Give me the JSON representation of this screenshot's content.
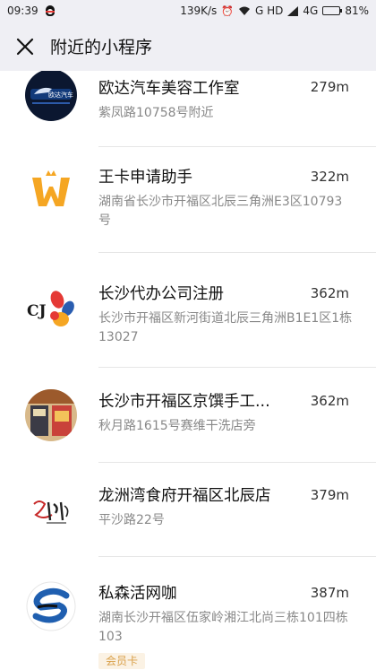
{
  "status_bar": {
    "time": "09:39",
    "speed": "139K/s",
    "network": "G HD",
    "signal": "4G",
    "battery": "81%",
    "battery_level": 0.81,
    "icons": [
      "qq-icon",
      "alarm-icon",
      "wifi-icon",
      "signal-icon",
      "battery-icon"
    ]
  },
  "nav": {
    "close_icon": "close-icon",
    "title": "附近的小程序"
  },
  "items": [
    {
      "name": "欧达汽车美容工作室",
      "distance": "279m",
      "address": "紫凤路10758号附近",
      "logo": "auto-care-logo",
      "logo_text": "欧达汽车"
    },
    {
      "name": "王卡申请助手",
      "distance": "322m",
      "address": "湖南省长沙市开福区北辰三角洲E3区10793号",
      "logo": "wangka-crown-logo"
    },
    {
      "name": "长沙代办公司注册",
      "distance": "362m",
      "address": "长沙市开福区新河街道北辰三角洲B1E1区1栋13027",
      "logo": "cj-logo",
      "logo_text": "CJ"
    },
    {
      "name": "长沙市开福区京馔手工...",
      "distance": "362m",
      "address": "秋月路1615号赛维干洗店旁",
      "logo": "storefront-photo"
    },
    {
      "name": "龙洲湾食府开福区北辰店",
      "distance": "379m",
      "address": "平沙路22号",
      "logo": "calligraphy-logo"
    },
    {
      "name": "私森活网咖",
      "distance": "387m",
      "address": "湖南长沙开福区伍家岭湘江北尚三栋101四栋103",
      "logo": "s-swirl-logo",
      "badge": "会员卡"
    }
  ],
  "colors": {
    "header_bg": "#efeff4",
    "distance_text": "#333333",
    "address_text": "#888888",
    "badge_text": "#d9a04a",
    "crown_orange": "#f5a623"
  }
}
